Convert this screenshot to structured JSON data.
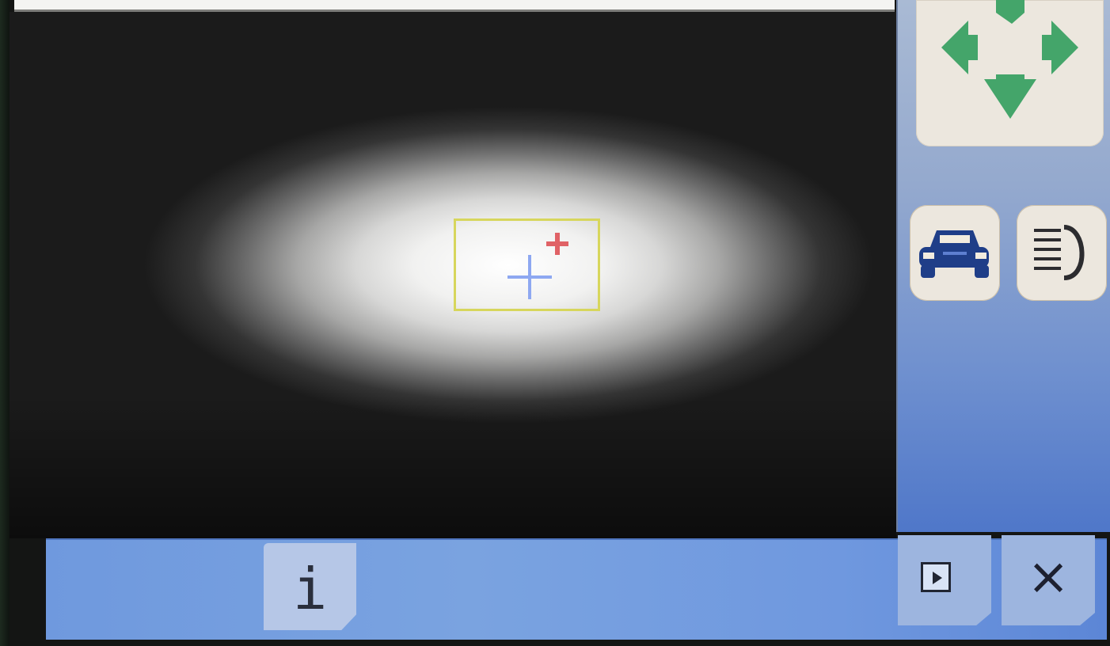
{
  "screen": {
    "title": ""
  },
  "controls": {
    "info": {
      "label": "i"
    },
    "close": {
      "label": "×"
    }
  },
  "icons": {
    "pan": "pan-arrows-icon",
    "car": "car-icon",
    "beam": "headlight-beam-icon",
    "play": "play-icon"
  },
  "colors": {
    "arrow_green": "#44a56a",
    "panel_blue": "#6f99de",
    "target_yellow": "#d7d65c",
    "crosshair_blue": "#8ea8f1",
    "crosshair_red": "#e06266",
    "car_navy": "#1f3e88"
  }
}
